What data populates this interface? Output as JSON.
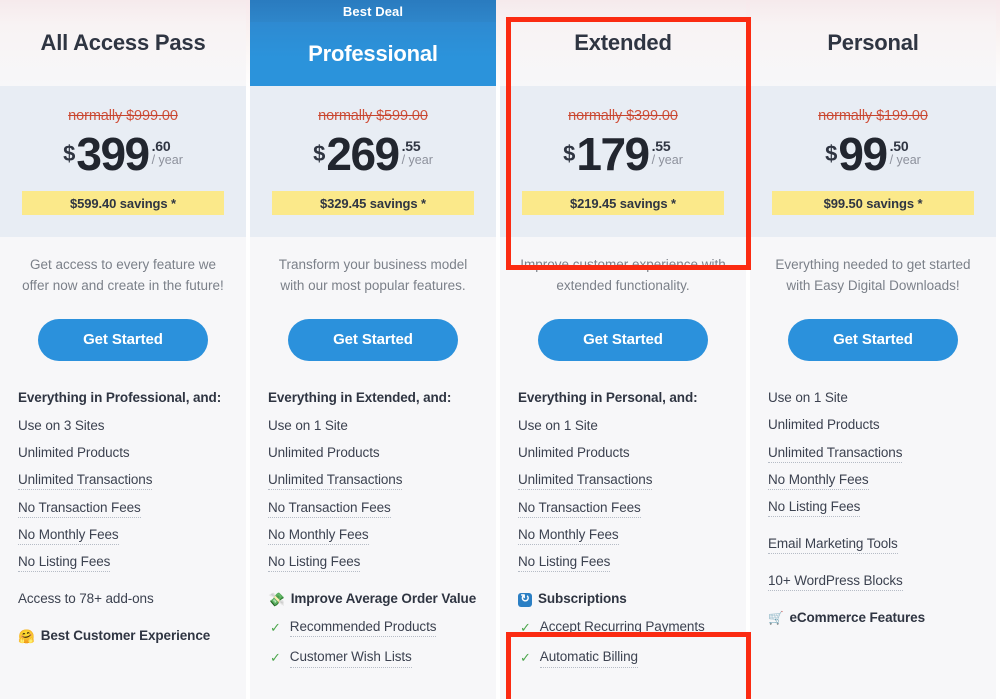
{
  "theme": {
    "accent_blue": "#2b91dc",
    "badge_blue": "#2a7bbf",
    "savings_yellow": "#fbe98a",
    "strike_red": "#d0503a",
    "annotation_red": "#fb2b12",
    "price_bg": "#e8edf4",
    "card_bg": "#f7f7f9",
    "text_dark": "#2f3542",
    "text_muted": "#7b8089",
    "check_green": "#4ca64c"
  },
  "plans": [
    {
      "name": "All Access Pass",
      "badge": null,
      "featured": false,
      "normally": "normally $999.00",
      "currency": "$",
      "amount": "399",
      "cents": ".60",
      "per": "/ year",
      "savings": "$599.40 savings *",
      "description": "Get access to every feature we offer now and create in the future!",
      "cta": "Get Started",
      "features": [
        {
          "text": "Everything in Professional, and:",
          "style": "head"
        },
        {
          "text": "Use on 3 Sites",
          "style": "plain"
        },
        {
          "text": "Unlimited Products",
          "style": "plain"
        },
        {
          "text": "Unlimited Transactions",
          "style": "dotted"
        },
        {
          "text": "No Transaction Fees",
          "style": "dotted"
        },
        {
          "text": "No Monthly Fees",
          "style": "dotted"
        },
        {
          "text": "No Listing Fees",
          "style": "dotted"
        },
        {
          "text": "Access to 78+ add-ons",
          "style": "plain",
          "gap": true
        },
        {
          "text": "Best Customer Experience",
          "style": "section",
          "icon": "hugging-face-emoji",
          "glyph": "🤗",
          "gap": true
        }
      ]
    },
    {
      "name": "Professional",
      "badge": "Best Deal",
      "featured": true,
      "normally": "normally $599.00",
      "currency": "$",
      "amount": "269",
      "cents": ".55",
      "per": "/ year",
      "savings": "$329.45 savings *",
      "description": "Transform your business model with our most popular features.",
      "cta": "Get Started",
      "features": [
        {
          "text": "Everything in Extended, and:",
          "style": "head"
        },
        {
          "text": "Use on 1 Site",
          "style": "plain"
        },
        {
          "text": "Unlimited Products",
          "style": "plain"
        },
        {
          "text": "Unlimited Transactions",
          "style": "dotted"
        },
        {
          "text": "No Transaction Fees",
          "style": "dotted"
        },
        {
          "text": "No Monthly Fees",
          "style": "dotted"
        },
        {
          "text": "No Listing Fees",
          "style": "dotted"
        },
        {
          "text": "Improve Average Order Value",
          "style": "section",
          "icon": "money-with-wings-emoji",
          "glyph": "💸",
          "gap": true
        },
        {
          "text": "Recommended Products",
          "style": "check-dotted"
        },
        {
          "text": "Customer Wish Lists",
          "style": "check-dotted",
          "clipped": true
        }
      ]
    },
    {
      "name": "Extended",
      "badge": null,
      "featured": false,
      "normally": "normally $399.00",
      "currency": "$",
      "amount": "179",
      "cents": ".55",
      "per": "/ year",
      "savings": "$219.45 savings *",
      "description": "Improve customer experience with extended functionality.",
      "cta": "Get Started",
      "features": [
        {
          "text": "Everything in Personal, and:",
          "style": "head"
        },
        {
          "text": "Use on 1 Site",
          "style": "plain"
        },
        {
          "text": "Unlimited Products",
          "style": "plain"
        },
        {
          "text": "Unlimited Transactions",
          "style": "dotted"
        },
        {
          "text": "No Transaction Fees",
          "style": "dotted"
        },
        {
          "text": "No Monthly Fees",
          "style": "dotted"
        },
        {
          "text": "No Listing Fees",
          "style": "dotted"
        },
        {
          "text": "Subscriptions",
          "style": "section",
          "icon": "subscriptions-icon",
          "glyph": "",
          "gap": true
        },
        {
          "text": "Accept Recurring Payments",
          "style": "check-dotted"
        },
        {
          "text": "Automatic Billing",
          "style": "check-dotted",
          "clipped": true
        }
      ]
    },
    {
      "name": "Personal",
      "badge": null,
      "featured": false,
      "normally": "normally $199.00",
      "currency": "$",
      "amount": "99",
      "cents": ".50",
      "per": "/ year",
      "savings": "$99.50 savings *",
      "description": "Everything needed to get started with Easy Digital Downloads!",
      "cta": "Get Started",
      "features": [
        {
          "text": "Use on 1 Site",
          "style": "plain"
        },
        {
          "text": "Unlimited Products",
          "style": "plain"
        },
        {
          "text": "Unlimited Transactions",
          "style": "dotted"
        },
        {
          "text": "No Monthly Fees",
          "style": "dotted"
        },
        {
          "text": "No Listing Fees",
          "style": "dotted"
        },
        {
          "text": "Email Marketing Tools",
          "style": "dotted",
          "gap": true
        },
        {
          "text": "10+ WordPress Blocks",
          "style": "dotted",
          "gap": true
        },
        {
          "text": "eCommerce Features",
          "style": "section",
          "icon": "shopping-cart-emoji",
          "glyph": "🛒",
          "gap": true
        }
      ]
    }
  ],
  "annotations": [
    {
      "name": "extended-price-highlight",
      "target": "Extended price block"
    },
    {
      "name": "extended-subscriptions-highlight",
      "target": "Extended subscriptions feature"
    }
  ]
}
